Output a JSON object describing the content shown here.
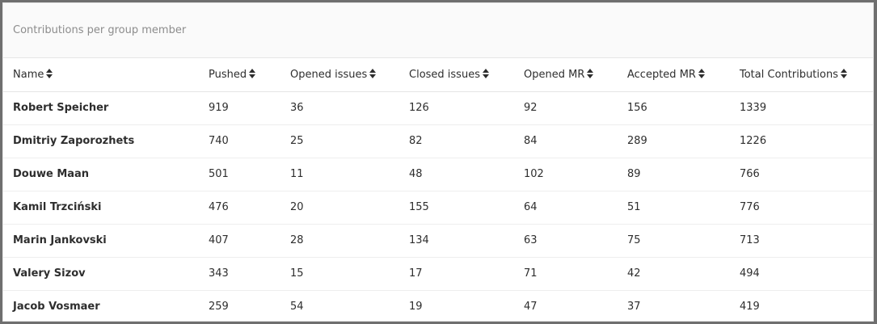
{
  "panel": {
    "title": "Contributions per group member"
  },
  "table": {
    "columns": [
      {
        "key": "name",
        "label": "Name"
      },
      {
        "key": "pushed",
        "label": "Pushed"
      },
      {
        "key": "opened_issues",
        "label": "Opened issues"
      },
      {
        "key": "closed_issues",
        "label": "Closed issues"
      },
      {
        "key": "opened_mr",
        "label": "Opened MR"
      },
      {
        "key": "accepted_mr",
        "label": "Accepted MR"
      },
      {
        "key": "total",
        "label": "Total Contributions"
      }
    ],
    "rows": [
      {
        "name": "Robert Speicher",
        "pushed": "919",
        "opened_issues": "36",
        "closed_issues": "126",
        "opened_mr": "92",
        "accepted_mr": "156",
        "total": "1339"
      },
      {
        "name": "Dmitriy Zaporozhets",
        "pushed": "740",
        "opened_issues": "25",
        "closed_issues": "82",
        "opened_mr": "84",
        "accepted_mr": "289",
        "total": "1226"
      },
      {
        "name": "Douwe Maan",
        "pushed": "501",
        "opened_issues": "11",
        "closed_issues": "48",
        "opened_mr": "102",
        "accepted_mr": "89",
        "total": "766"
      },
      {
        "name": "Kamil Trzciński",
        "pushed": "476",
        "opened_issues": "20",
        "closed_issues": "155",
        "opened_mr": "64",
        "accepted_mr": "51",
        "total": "776"
      },
      {
        "name": "Marin Jankovski",
        "pushed": "407",
        "opened_issues": "28",
        "closed_issues": "134",
        "opened_mr": "63",
        "accepted_mr": "75",
        "total": "713"
      },
      {
        "name": "Valery Sizov",
        "pushed": "343",
        "opened_issues": "15",
        "closed_issues": "17",
        "opened_mr": "71",
        "accepted_mr": "42",
        "total": "494"
      },
      {
        "name": "Jacob Vosmaer",
        "pushed": "259",
        "opened_issues": "54",
        "closed_issues": "19",
        "opened_mr": "47",
        "accepted_mr": "37",
        "total": "419"
      }
    ]
  },
  "icons": {
    "sort": "sort-icon"
  },
  "colors": {
    "text": "#2e2e2e",
    "muted": "#8c8c8c",
    "header_bg": "#fafafa",
    "border": "#e5e5e5"
  }
}
